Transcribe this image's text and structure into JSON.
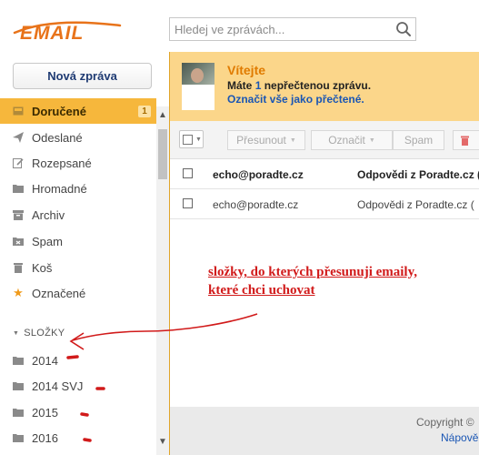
{
  "header": {
    "logo_text": "EMAIL",
    "search": {
      "placeholder": "Hledej ve zprávách...",
      "value": ""
    }
  },
  "sidebar": {
    "new_message_label": "Nová zpráva",
    "items": [
      {
        "label": "Doručené",
        "icon": "inbox-icon",
        "badge": "1",
        "active": true
      },
      {
        "label": "Odeslané",
        "icon": "send-icon"
      },
      {
        "label": "Rozepsané",
        "icon": "draft-icon"
      },
      {
        "label": "Hromadné",
        "icon": "folder-icon"
      },
      {
        "label": "Archiv",
        "icon": "archive-icon"
      },
      {
        "label": "Spam",
        "icon": "spam-icon"
      },
      {
        "label": "Koš",
        "icon": "trash-icon"
      },
      {
        "label": "Označené",
        "icon": "star-icon"
      }
    ],
    "folders_heading": "SLOŽKY",
    "folders": [
      {
        "label": "2014",
        "icon": "folder-icon"
      },
      {
        "label": "2014 SVJ",
        "icon": "folder-icon"
      },
      {
        "label": "2015",
        "icon": "folder-icon"
      },
      {
        "label": "2016",
        "icon": "folder-icon"
      }
    ]
  },
  "welcome": {
    "title": "Vítejte",
    "text_before": "Máte ",
    "count": "1",
    "text_after": " nepřečtenou zprávu.",
    "mark_all_link": "Označit vše jako přečtené."
  },
  "toolbar": {
    "move_label": "Přesunout",
    "mark_label": "Označit",
    "spam_label": "Spam"
  },
  "messages": [
    {
      "from": "echo@poradte.cz",
      "subject": "Odpovědi z Poradte.cz (",
      "unread": true
    },
    {
      "from": "echo@poradte.cz",
      "subject": "Odpovědi z Poradte.cz (",
      "unread": false
    }
  ],
  "footer": {
    "copyright": "Copyright ©",
    "help_link": "Nápově"
  },
  "annotation": {
    "line1": "složky, do kterých přesunuji emaily,",
    "line2": "které chci uchovat",
    "color": "#d11a1a"
  },
  "colors": {
    "accent": "#f6b73c",
    "welcome_bg": "#fbd68a",
    "link": "#1a56b4",
    "logo": "#e8731a"
  }
}
